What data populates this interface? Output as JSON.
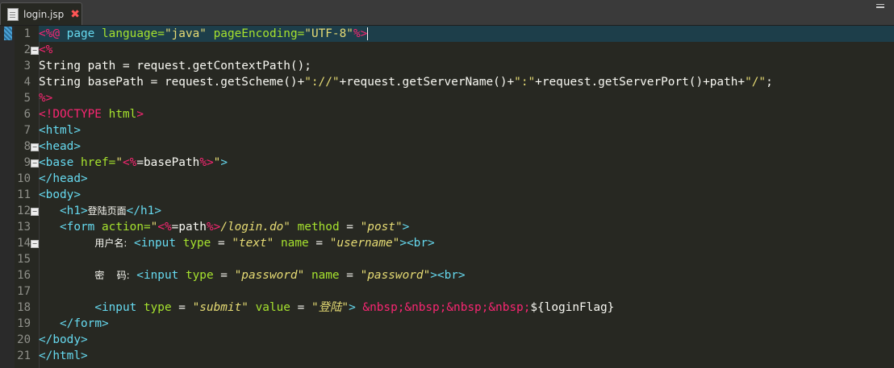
{
  "tab": {
    "filename": "login.jsp"
  },
  "code": {
    "line_numbers": [
      "1",
      "2",
      "3",
      "4",
      "5",
      "6",
      "7",
      "8",
      "9",
      "10",
      "11",
      "12",
      "13",
      "14",
      "15",
      "16",
      "17",
      "18",
      "19",
      "20",
      "21"
    ],
    "line1": {
      "open": "<%@",
      "page": "page",
      "lang_attr": "language=",
      "lang_val": "\"java\"",
      "enc_attr": "pageEncoding=",
      "enc_val": "\"UTF-8\"",
      "close": "%>"
    },
    "line2": "<%",
    "line3": "String path = request.getContextPath();",
    "line4": {
      "pre": "String basePath = request.getScheme()+",
      "s1": "\"://\"",
      "mid1": "+request.getServerName()+",
      "s2": "\":\"",
      "mid2": "+request.getServerPort()+path+",
      "s3": "\"/\"",
      "end": ";"
    },
    "line5": "%>",
    "line6": {
      "doctype": "<!DOCTYPE",
      "html": "html",
      "gt": ">"
    },
    "line7": "<html>",
    "line8": "<head>",
    "line9": {
      "base": "<base",
      "href": "href=",
      "q1": "\"",
      "expr_open": "<%",
      "expr": "=basePath",
      "expr_close": "%>",
      "q2": "\"",
      "gt": ">"
    },
    "line10": "</head>",
    "line11": "<body>",
    "line12": {
      "open": "<h1>",
      "text": "登陆页面",
      "close": "</h1>"
    },
    "line13": {
      "form": "<form",
      "action": "action=",
      "q1": "\"",
      "expr_open": "<%",
      "expr": "=path",
      "expr_close": "%>",
      "path": "/login.do",
      "q2": "\"",
      "method": "method",
      "eq": "=",
      "method_val": "\"post\"",
      "gt": ">"
    },
    "line14": {
      "label": "用户名:",
      "input": "<input",
      "type": "type",
      "eq1": "=",
      "type_val": "\"text\"",
      "name": "name",
      "eq2": "=",
      "name_val": "\"username\"",
      "gt": ">",
      "br": "<br>"
    },
    "line16": {
      "label": "密    码:",
      "input": "<input",
      "type": "type",
      "eq1": "=",
      "type_val": "\"password\"",
      "name": "name",
      "eq2": "=",
      "name_val": "\"password\"",
      "gt": ">",
      "br": "<br>"
    },
    "line18": {
      "input": "<input",
      "type": "type",
      "eq1": "=",
      "type_val": "\"submit\"",
      "value": "value",
      "eq2": "=",
      "value_val": "\"登陆\"",
      "gt": ">",
      "nbsp": "&nbsp;&nbsp;&nbsp;&nbsp;",
      "el": "${loginFlag}"
    },
    "line19": "</form>",
    "line20": "</body>",
    "line21": "</html>"
  }
}
